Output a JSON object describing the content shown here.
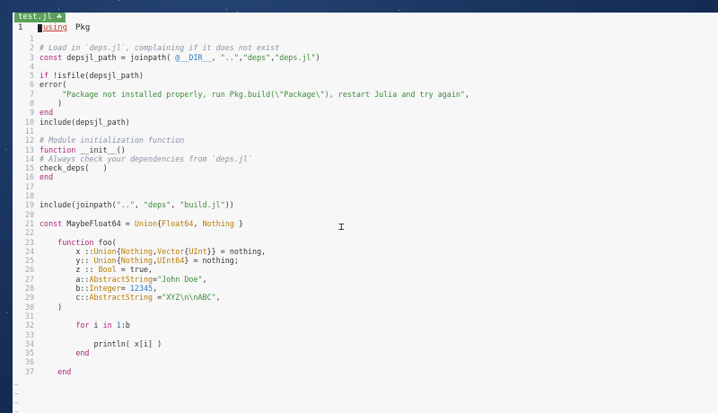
{
  "tab": {
    "label": "test.jl ☘"
  },
  "current_line": {
    "number": "1",
    "keyword": "using",
    "rest": "Pkg"
  },
  "code_lines": [
    {
      "n": "1",
      "html": ""
    },
    {
      "n": "2",
      "html": "<span class='c'># Load in `deps.jl`, complaining if it does not exist</span>"
    },
    {
      "n": "3",
      "html": "<span class='k'>const</span> depsjl_path = joinpath( <span class='n'>@__DIR__</span>, <span class='s'>\"..\"</span>,<span class='s'>\"deps\"</span>,<span class='s'>\"deps.jl\"</span>)"
    },
    {
      "n": "4",
      "html": ""
    },
    {
      "n": "5",
      "html": "<span class='k'>if</span> !isfile(depsjl_path)"
    },
    {
      "n": "6",
      "html": "error("
    },
    {
      "n": "7",
      "html": "     <span class='s'>\"Package not installed properly, run Pkg.build(\\\"Package\\\"), restart Julia and try again\"</span>,"
    },
    {
      "n": "8",
      "html": "    )"
    },
    {
      "n": "9",
      "html": "<span class='k'>end</span>"
    },
    {
      "n": "10",
      "html": "include(depsjl_path)"
    },
    {
      "n": "11",
      "html": ""
    },
    {
      "n": "12",
      "html": "<span class='c'># Module initialization function</span>"
    },
    {
      "n": "13",
      "html": "<span class='k'>function</span> __init__()"
    },
    {
      "n": "14",
      "html": "<span class='c'># Always check your dependencies from `deps.jl`</span>"
    },
    {
      "n": "15",
      "html": "check_deps(   )"
    },
    {
      "n": "16",
      "html": "<span class='k'>end</span>"
    },
    {
      "n": "17",
      "html": ""
    },
    {
      "n": "18",
      "html": ""
    },
    {
      "n": "19",
      "html": "include(joinpath(<span class='s'>\"..\"</span>, <span class='s'>\"deps\"</span>, <span class='s'>\"build.jl\"</span>))"
    },
    {
      "n": "20",
      "html": ""
    },
    {
      "n": "21",
      "html": "<span class='k'>const</span> MaybeFloat64 = <span class='t'>Union</span>{<span class='t'>Float64</span>, <span class='t'>Nothing</span> }"
    },
    {
      "n": "22",
      "html": ""
    },
    {
      "n": "23",
      "html": "    <span class='k'>function</span> foo("
    },
    {
      "n": "24",
      "html": "        x ::<span class='t'>Union</span>{<span class='t'>Nothing</span>,<span class='t'>Vector</span>{<span class='t'>UInt</span>}} = nothing,"
    },
    {
      "n": "25",
      "html": "        y:: <span class='t'>Union</span>{<span class='t'>Nothing</span>,<span class='t'>UInt64</span>} = nothing;"
    },
    {
      "n": "26",
      "html": "        z :: <span class='t'>Bool</span> = true,"
    },
    {
      "n": "27",
      "html": "        a::<span class='t'>AbstractString</span>=<span class='s'>\"John Doe\"</span>,"
    },
    {
      "n": "28",
      "html": "        b::<span class='t'>Integer</span>= <span class='n'>12345</span>,"
    },
    {
      "n": "29",
      "html": "        c::<span class='t'>AbstractString</span> =<span class='s'>\"XYZ\\n\\nABC\"</span>,"
    },
    {
      "n": "30",
      "html": "    )"
    },
    {
      "n": "31",
      "html": ""
    },
    {
      "n": "32",
      "html": "        <span class='k'>for</span> i <span class='k'>in</span> <span class='n'>1</span>:b"
    },
    {
      "n": "33",
      "html": ""
    },
    {
      "n": "34",
      "html": "            println( x[i] )"
    },
    {
      "n": "35",
      "html": "        <span class='k'>end</span>"
    },
    {
      "n": "36",
      "html": ""
    },
    {
      "n": "37",
      "html": "    <span class='k'>end</span>"
    }
  ],
  "tildes": [
    "~",
    "~",
    "~",
    "~",
    "~"
  ],
  "colors": {
    "keyword": "#b0227a",
    "string": "#3a8a3a",
    "type": "#b77a00",
    "comment": "#8a94a6",
    "tab": "#5aa05a"
  }
}
